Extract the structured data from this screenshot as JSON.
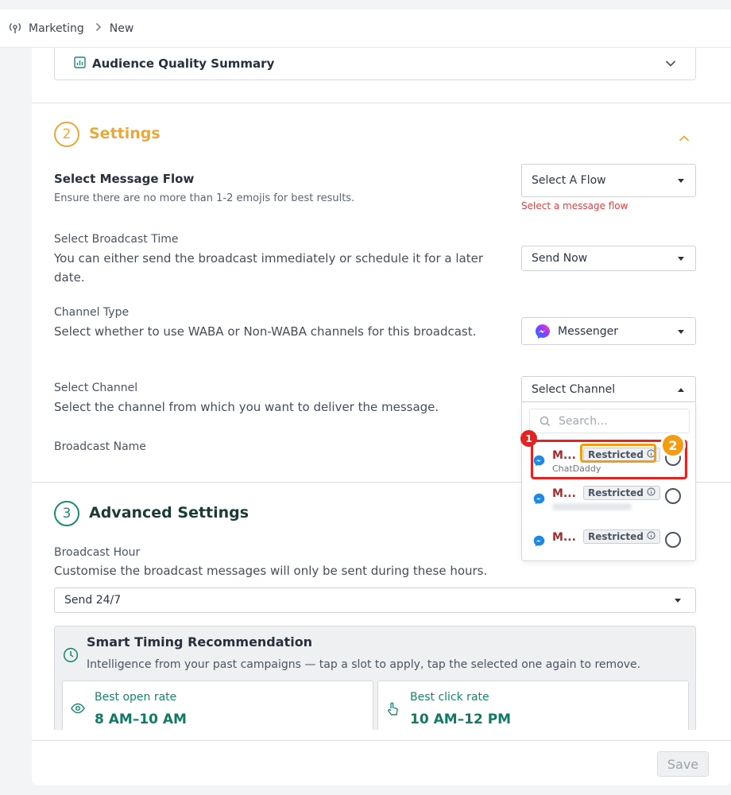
{
  "breadcrumb": {
    "root": "Marketing",
    "current": "New"
  },
  "audience_quality": {
    "title": "Audience Quality Summary"
  },
  "settings": {
    "number": "2",
    "title": "Settings",
    "color": "#e8a93a",
    "message_flow": {
      "title": "Select Message Flow",
      "description": "Ensure there are no more than 1-2 emojis for best results.",
      "select_value": "Select A Flow",
      "error": "Select a message flow"
    },
    "broadcast_time": {
      "label": "Select Broadcast Time",
      "description": "You can either send the broadcast immediately or schedule it for a later date.",
      "select_value": "Send Now"
    },
    "channel_type": {
      "label": "Channel Type",
      "description": "Select whether to use WABA or Non-WABA channels for this broadcast.",
      "select_value": "Messenger"
    },
    "channel": {
      "label": "Select Channel",
      "description": "Select the channel from which you want to deliver the message.",
      "select_value": "Select Channel",
      "search_placeholder": "Search...",
      "options": [
        {
          "name": "M...",
          "badge": "Restricted",
          "sub": "ChatDaddy"
        },
        {
          "name": "M...",
          "badge": "Restricted",
          "sub": ""
        },
        {
          "name": "M...",
          "badge": "Restricted",
          "sub": ""
        }
      ]
    },
    "broadcast_name": {
      "label": "Broadcast Name"
    }
  },
  "advanced": {
    "number": "3",
    "title": "Advanced Settings",
    "color": "#1a8a74",
    "broadcast_hour": {
      "label": "Broadcast Hour",
      "description": "Customise the broadcast messages will only be sent during these hours.",
      "select_value": "Send 24/7"
    },
    "smart_timing": {
      "title": "Smart Timing Recommendation",
      "description": "Intelligence from your past campaigns — tap a slot to apply, tap the selected one again to remove.",
      "cards": [
        {
          "label": "Best open rate",
          "value": "8 AM–10 AM",
          "icon": "eye-icon"
        },
        {
          "label": "Best click rate",
          "value": "10 AM–12 PM",
          "icon": "pointer-icon"
        }
      ]
    }
  },
  "annotations": {
    "marker1": "1",
    "marker2": "2",
    "red": "#e32222",
    "orange": "#f39c12"
  },
  "footer": {
    "save_label": "Save"
  }
}
